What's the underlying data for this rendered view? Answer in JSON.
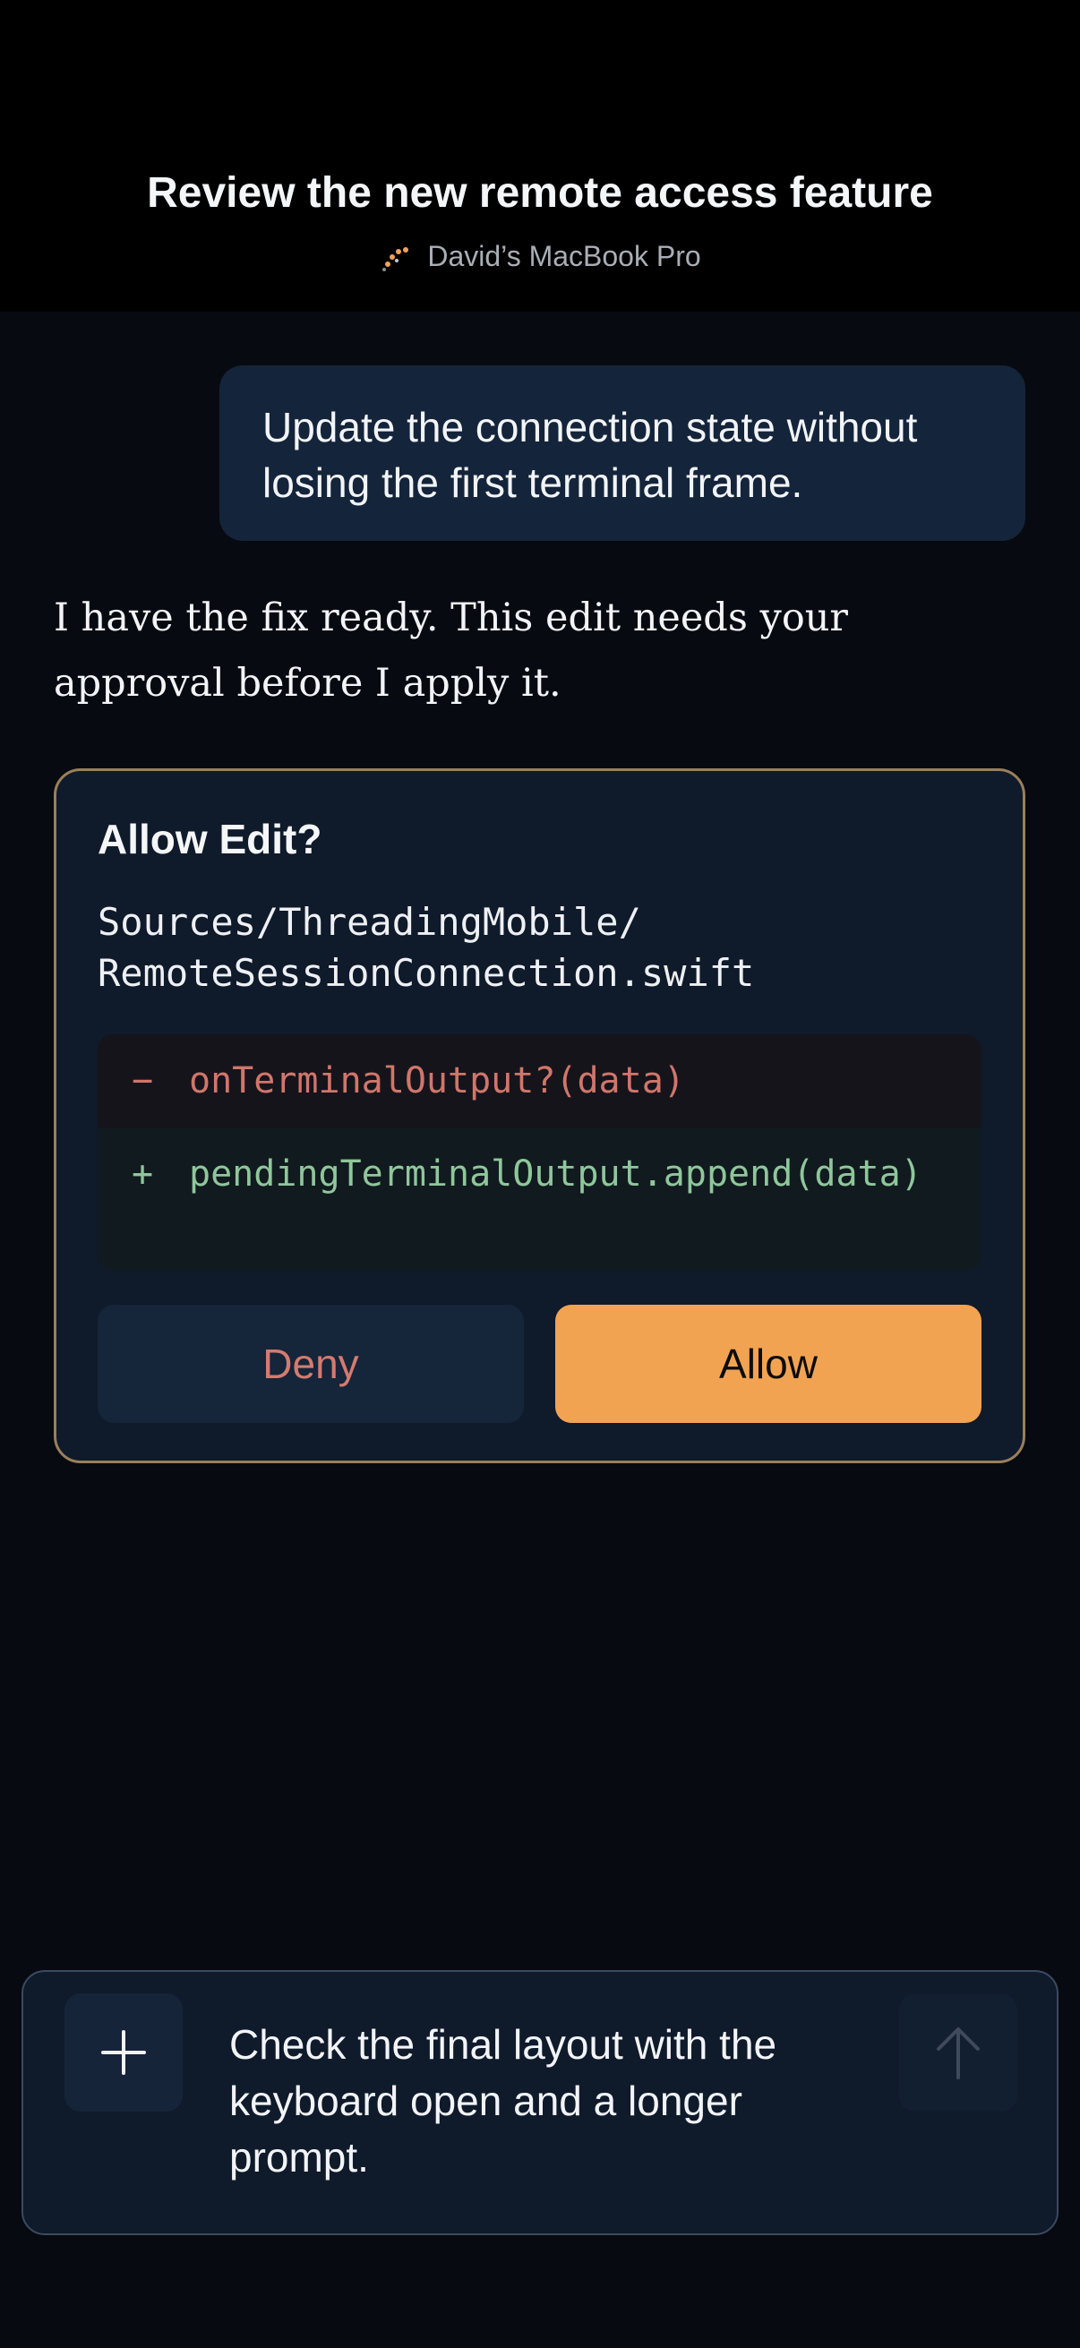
{
  "header": {
    "title": "Review the new remote access feature",
    "device_name": "David’s MacBook Pro",
    "device_icon": "spinner-dots-icon"
  },
  "conversation": {
    "user_message": "Update the connection state without losing the first terminal frame.",
    "assistant_message": "I have the fix ready. This edit needs your approval before I apply it."
  },
  "approval": {
    "title": "Allow Edit?",
    "file_path": "Sources/ThreadingMobile/\nRemoteSessionConnection.swift",
    "diff": {
      "removed_sign": "−",
      "removed_line": "onTerminalOutput?(data)",
      "added_sign": "+",
      "added_line": "pendingTerminalOutput.append(data)"
    },
    "deny_label": "Deny",
    "allow_label": "Allow"
  },
  "composer": {
    "text": "Check the final layout with the keyboard open and a longer prompt.",
    "add_icon": "plus-icon",
    "send_icon": "arrow-up-icon"
  },
  "colors": {
    "accent": "#f2a352",
    "removed": "#d0766b",
    "added": "#8fc79b",
    "card_border": "#9b7f5a"
  }
}
